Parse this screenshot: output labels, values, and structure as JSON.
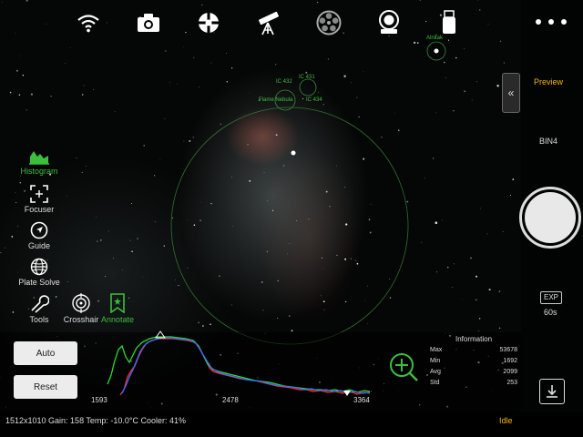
{
  "toolbar": {
    "icons": [
      "wifi-icon",
      "camera-icon",
      "mount-icon",
      "telescope-icon",
      "filter-wheel-icon",
      "focuser-device-icon",
      "usb-device-icon"
    ]
  },
  "overlay": {
    "labels": [
      "Alnitak",
      "IC 432",
      "IC 431",
      "Flame Nebula",
      "IC 434"
    ]
  },
  "left_tools": {
    "histogram": "Histogram",
    "focuser": "Focuser",
    "guide": "Guide",
    "plate_solve": "Plate Solve",
    "tools": "Tools",
    "crosshair": "Crosshair",
    "annotate": "Annotate"
  },
  "right_panel": {
    "preview": "Preview",
    "bin": "BIN4",
    "exp_label": "EXP",
    "exp_value": "60s"
  },
  "histogram_panel": {
    "auto": "Auto",
    "reset": "Reset",
    "ticks": [
      "1593",
      "2478",
      "3364"
    ]
  },
  "information": {
    "title": "Information",
    "max_label": "Max",
    "max": "53678",
    "min_label": "Min",
    "min": "1692",
    "avg_label": "Avg",
    "avg": "2099",
    "std_label": "Std",
    "std": "253"
  },
  "status": {
    "left": "1512x1010  Gain: 158  Temp: -10.0°C  Cooler: 41%",
    "right": "Idle"
  },
  "colors": {
    "accent_green": "#3cbf3c",
    "accent_yellow": "#f5b800"
  }
}
